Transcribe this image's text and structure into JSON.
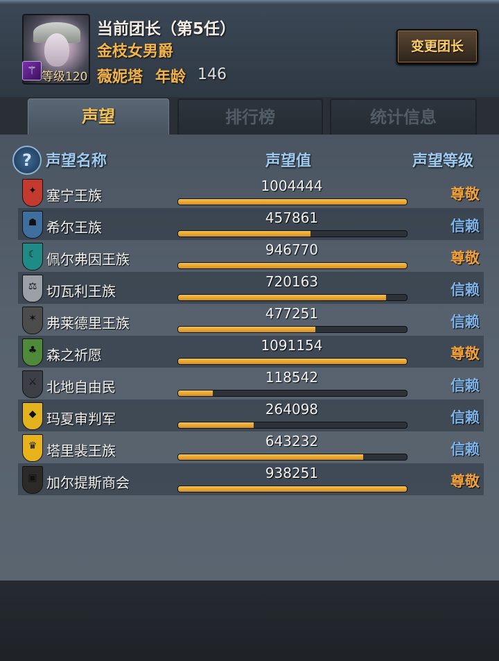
{
  "header": {
    "leader_title": "当前团长（第5任）",
    "leader_rank": "金枝女男爵",
    "leader_name": "薇妮塔",
    "age_label": "年龄",
    "age_value": "146",
    "level_label": "等级120",
    "change_button": "变更团长"
  },
  "tabs": [
    {
      "label": "声望",
      "active": true
    },
    {
      "label": "排行榜",
      "active": false
    },
    {
      "label": "统计信息",
      "active": false
    }
  ],
  "columns": {
    "name": "声望名称",
    "value": "声望值",
    "level": "声望等级"
  },
  "colors": {
    "revered": "#f0a13a",
    "trusted": "#7fb6ec"
  },
  "reputations": [
    {
      "name": "塞宁王族",
      "value": "1004444",
      "progress": 1.0,
      "level": "尊敬",
      "tier": "revered",
      "emblem_color": "#c43a2e",
      "emblem_glyph": "✦"
    },
    {
      "name": "希尔王族",
      "value": "457861",
      "progress": 0.58,
      "level": "信赖",
      "tier": "trusted",
      "emblem_color": "#3f6f9e",
      "emblem_glyph": "☗"
    },
    {
      "name": "佩尔弗因王族",
      "value": "946770",
      "progress": 1.0,
      "level": "尊敬",
      "tier": "revered",
      "emblem_color": "#1e8b86",
      "emblem_glyph": "☾"
    },
    {
      "name": "切瓦利王族",
      "value": "720163",
      "progress": 0.91,
      "level": "信赖",
      "tier": "trusted",
      "emblem_color": "#9aa0a6",
      "emblem_glyph": "⚖"
    },
    {
      "name": "弗莱德里王族",
      "value": "477251",
      "progress": 0.6,
      "level": "信赖",
      "tier": "trusted",
      "emblem_color": "#4c4c4c",
      "emblem_glyph": "✶"
    },
    {
      "name": "森之祈愿",
      "value": "1091154",
      "progress": 1.0,
      "level": "尊敬",
      "tier": "revered",
      "emblem_color": "#4e8a3a",
      "emblem_glyph": "♣"
    },
    {
      "name": "北地自由民",
      "value": "118542",
      "progress": 0.15,
      "level": "信赖",
      "tier": "trusted",
      "emblem_color": "#3c4046",
      "emblem_glyph": "⚔"
    },
    {
      "name": "玛夏审判军",
      "value": "264098",
      "progress": 0.33,
      "level": "信赖",
      "tier": "trusted",
      "emblem_color": "#e2b31c",
      "emblem_glyph": "◆"
    },
    {
      "name": "塔里裴王族",
      "value": "643232",
      "progress": 0.81,
      "level": "信赖",
      "tier": "trusted",
      "emblem_color": "#e7b21a",
      "emblem_glyph": "♛"
    },
    {
      "name": "加尔提斯商会",
      "value": "938251",
      "progress": 1.0,
      "level": "尊敬",
      "tier": "revered",
      "emblem_color": "#2c2a26",
      "emblem_glyph": "▣"
    }
  ]
}
